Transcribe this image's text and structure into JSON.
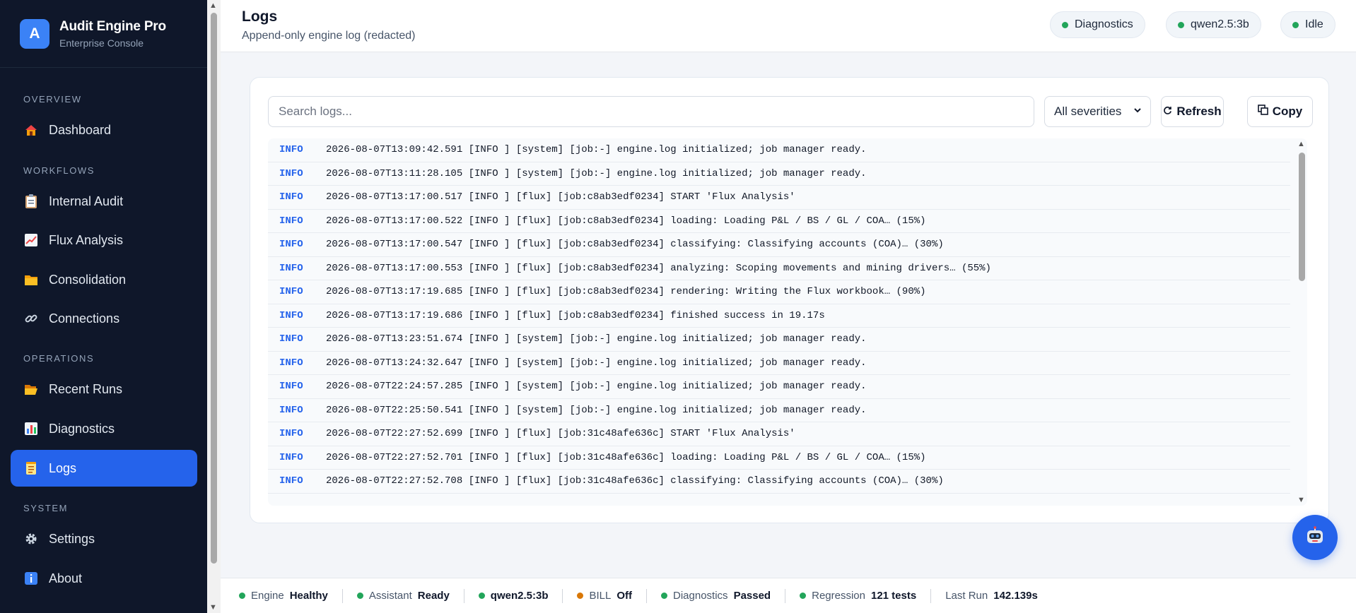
{
  "brand": {
    "logo_letter": "A",
    "title": "Audit Engine Pro",
    "subtitle": "Enterprise Console"
  },
  "sidebar": {
    "sections": {
      "overview": "OVERVIEW",
      "workflows": "WORKFLOWS",
      "operations": "OPERATIONS",
      "system": "SYSTEM"
    },
    "items": [
      {
        "label": "Dashboard",
        "icon": "house-icon"
      },
      {
        "label": "Internal Audit",
        "icon": "clipboard-icon"
      },
      {
        "label": "Flux Analysis",
        "icon": "chart-up-icon"
      },
      {
        "label": "Consolidation",
        "icon": "folder-icon"
      },
      {
        "label": "Connections",
        "icon": "link-icon"
      },
      {
        "label": "Recent Runs",
        "icon": "open-folder-icon"
      },
      {
        "label": "Diagnostics",
        "icon": "bar-chart-icon"
      },
      {
        "label": "Logs",
        "icon": "scroll-icon",
        "active": true
      },
      {
        "label": "Settings",
        "icon": "gear-icon"
      },
      {
        "label": "About",
        "icon": "info-icon"
      }
    ]
  },
  "header": {
    "title": "Logs",
    "subtitle": "Append-only engine log (redacted)",
    "pills": [
      "Diagnostics",
      "qwen2.5:3b",
      "Idle"
    ]
  },
  "toolbar": {
    "search_placeholder": "Search logs...",
    "severity_selected": "All severities",
    "refresh_label": "Refresh",
    "copy_label": "Copy"
  },
  "logs": [
    {
      "sev": "INFO",
      "msg": "2026-08-07T13:09:42.591 [INFO ] [system] [job:-] engine.log initialized; job manager ready."
    },
    {
      "sev": "INFO",
      "msg": "2026-08-07T13:11:28.105 [INFO ] [system] [job:-] engine.log initialized; job manager ready."
    },
    {
      "sev": "INFO",
      "msg": "2026-08-07T13:17:00.517 [INFO ] [flux] [job:c8ab3edf0234] START 'Flux Analysis'"
    },
    {
      "sev": "INFO",
      "msg": "2026-08-07T13:17:00.522 [INFO ] [flux] [job:c8ab3edf0234] loading: Loading P&L / BS / GL / COA… (15%)"
    },
    {
      "sev": "INFO",
      "msg": "2026-08-07T13:17:00.547 [INFO ] [flux] [job:c8ab3edf0234] classifying: Classifying accounts (COA)… (30%)"
    },
    {
      "sev": "INFO",
      "msg": "2026-08-07T13:17:00.553 [INFO ] [flux] [job:c8ab3edf0234] analyzing: Scoping movements and mining drivers… (55%)"
    },
    {
      "sev": "INFO",
      "msg": "2026-08-07T13:17:19.685 [INFO ] [flux] [job:c8ab3edf0234] rendering: Writing the Flux workbook… (90%)"
    },
    {
      "sev": "INFO",
      "msg": "2026-08-07T13:17:19.686 [INFO ] [flux] [job:c8ab3edf0234] finished success in 19.17s"
    },
    {
      "sev": "INFO",
      "msg": "2026-08-07T13:23:51.674 [INFO ] [system] [job:-] engine.log initialized; job manager ready."
    },
    {
      "sev": "INFO",
      "msg": "2026-08-07T13:24:32.647 [INFO ] [system] [job:-] engine.log initialized; job manager ready."
    },
    {
      "sev": "INFO",
      "msg": "2026-08-07T22:24:57.285 [INFO ] [system] [job:-] engine.log initialized; job manager ready."
    },
    {
      "sev": "INFO",
      "msg": "2026-08-07T22:25:50.541 [INFO ] [system] [job:-] engine.log initialized; job manager ready."
    },
    {
      "sev": "INFO",
      "msg": "2026-08-07T22:27:52.699 [INFO ] [flux] [job:31c48afe636c] START 'Flux Analysis'"
    },
    {
      "sev": "INFO",
      "msg": "2026-08-07T22:27:52.701 [INFO ] [flux] [job:31c48afe636c] loading: Loading P&L / BS / GL / COA… (15%)"
    },
    {
      "sev": "INFO",
      "msg": "2026-08-07T22:27:52.708 [INFO ] [flux] [job:31c48afe636c] classifying: Classifying accounts (COA)… (30%)"
    }
  ],
  "footer": [
    {
      "label": "Engine",
      "value": "Healthy",
      "dot": "#22a55a"
    },
    {
      "label": "Assistant",
      "value": "Ready",
      "dot": "#22a55a"
    },
    {
      "label": "",
      "value": "qwen2.5:3b",
      "dot": "#22a55a"
    },
    {
      "label": "BILL",
      "value": "Off",
      "dot": "#d97706"
    },
    {
      "label": "Diagnostics",
      "value": "Passed",
      "dot": "#22a55a"
    },
    {
      "label": "Regression",
      "value": "121 tests",
      "dot": "#22a55a"
    },
    {
      "label": "Last Run",
      "value": "142.139s",
      "dot": ""
    }
  ],
  "colors": {
    "accent": "#2563eb",
    "sidebar_bg": "#0f172a",
    "ok": "#22a55a",
    "warn": "#d97706"
  },
  "assistant_fab": {
    "icon": "robot-icon"
  }
}
